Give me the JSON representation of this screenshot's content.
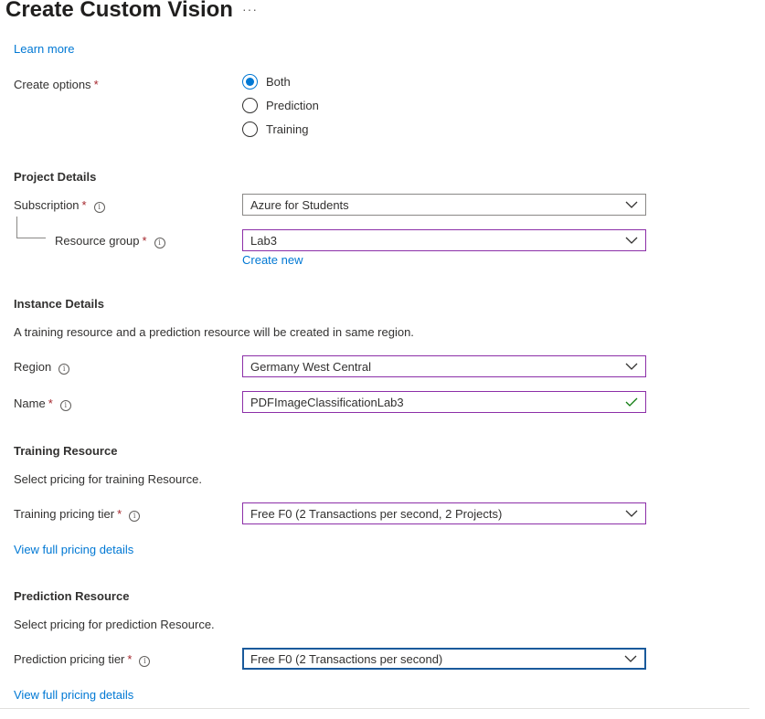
{
  "header": {
    "title": "Create Custom Vision",
    "more_label": "···"
  },
  "learn_more": "Learn more",
  "create_options": {
    "label": "Create options",
    "required_mark": "*",
    "options": [
      {
        "label": "Both",
        "selected": true
      },
      {
        "label": "Prediction",
        "selected": false
      },
      {
        "label": "Training",
        "selected": false
      }
    ]
  },
  "project_details": {
    "heading": "Project Details",
    "subscription": {
      "label": "Subscription",
      "required_mark": "*",
      "value": "Azure for Students"
    },
    "resource_group": {
      "label": "Resource group",
      "required_mark": "*",
      "value": "Lab3",
      "create_new": "Create new"
    }
  },
  "instance_details": {
    "heading": "Instance Details",
    "description": "A training resource and a prediction resource will be created in same region.",
    "region": {
      "label": "Region",
      "value": "Germany West Central"
    },
    "name": {
      "label": "Name",
      "required_mark": "*",
      "value": "PDFImageClassificationLab3"
    }
  },
  "training_resource": {
    "heading": "Training Resource",
    "description": "Select pricing for training Resource.",
    "tier": {
      "label": "Training pricing tier",
      "required_mark": "*",
      "value": "Free F0 (2 Transactions per second, 2 Projects)"
    },
    "pricing_link": "View full pricing details"
  },
  "prediction_resource": {
    "heading": "Prediction Resource",
    "description": "Select pricing for prediction Resource.",
    "tier": {
      "label": "Prediction pricing tier",
      "required_mark": "*",
      "value": "Free F0 (2 Transactions per second)"
    },
    "pricing_link": "View full pricing details"
  },
  "colors": {
    "accent": "#0078d4",
    "required": "#a4262c",
    "valid_field_border": "#8c2fa8",
    "focus_border": "#1a5a9b",
    "check": "#107c10"
  },
  "icons": {
    "info": "info-icon",
    "chevron": "chevron-down-icon",
    "validation": "checkmark-icon"
  }
}
